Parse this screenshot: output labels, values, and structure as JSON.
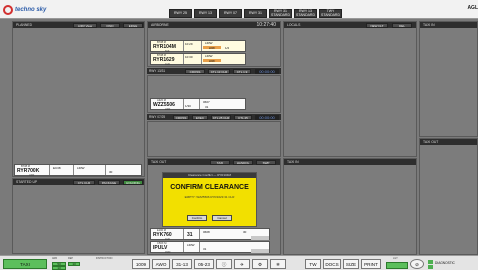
{
  "topbar": {
    "logo_text": "techno sky",
    "runway_buttons": [
      "RWY 25",
      "RWY 13",
      "RWY 07",
      "RWY 31",
      "RWY 31 STANDARD",
      "RWY 13 STANDARD",
      "TWY STANDARD"
    ],
    "user": "AGL"
  },
  "panels": {
    "planned": {
      "title": "PLANNED",
      "btn1": "AIRV View",
      "btn2": "FIND",
      "btn3": "EDGE"
    },
    "airborne": {
      "title": "AIRBORNE",
      "time": "10:27:40"
    },
    "locals": {
      "title": "LOCALS",
      "btn1": "NEW FLT",
      "btn2": "DEL"
    },
    "taxi_in": {
      "title": "TAXI IN"
    },
    "taxi_out_r": {
      "title": "TAXI OUT"
    },
    "startup": {
      "title": "STARTED UP",
      "btn1": "CTL CLR",
      "btn2": "PACKAGE",
      "btn3": "HOLDING"
    },
    "taxi_out": {
      "title": "TAXI OUT",
      "btn1": "TAXI",
      "btn2": "HANDOL",
      "btn3": "SWP"
    },
    "taxi_in_m": {
      "title": "TAXI IN"
    }
  },
  "bars": {
    "rwy1331": {
      "label": "RWY 13/31",
      "b1": "CROSS",
      "b2": "CTL 13 CLR",
      "b3": "CTL 1.9",
      "time": "00:00:00"
    },
    "rwy0725": {
      "label": "RWY 07/25",
      "b1": "CROSS",
      "b2": "EXEC",
      "b3": "CTL 25 CLR",
      "b4": "CTL 25",
      "time": "00:00:00"
    }
  },
  "strips": {
    "ryr104m": {
      "callsign": "RYR104M",
      "type": "B738 M",
      "sub": "TAK",
      "f1": "10:29",
      "f2": "LIRW",
      "f3": "LIRF",
      "f4": "1/2"
    },
    "ryr1629": {
      "callsign": "RYR1629",
      "type": "B738 M",
      "sub": "CLR",
      "f1": "10:30",
      "f2": "LIRW",
      "f3": "LIRF",
      "f4": ""
    },
    "wzz5506": {
      "callsign": "WZZ5506",
      "type": "A320 M",
      "sub": "LIRF",
      "f1": "1/30",
      "f2": "0607",
      "f3": "31",
      "f4": ""
    },
    "ryr700k": {
      "callsign": "RYR700K",
      "type": "B738 M",
      "sub": "LIRF",
      "f1": "EC38",
      "f2": "LIRW",
      "f3": "30",
      "f4": ""
    },
    "ryk760": {
      "callsign": "RYK760",
      "type": "E190 M",
      "sub": "CLR",
      "f1": "31",
      "f2": "0608",
      "f3": "30",
      "f4": ""
    },
    "ipulv": {
      "callsign": "IPULV",
      "type": "C56X M",
      "sub": "1530",
      "f1": "LIRW",
      "f2": "31",
      "f3": "",
      "f4": ""
    }
  },
  "dialog": {
    "titlebar": "Clearance Conflict — RYR104M",
    "title": "CONFIRM CLEARANCE",
    "message": "EMPTY: WZZ5506 RYR1629 31 CLR",
    "confirm": "Confirm",
    "cancel": "Cancel"
  },
  "bottombar": {
    "taxi_label": "TAXI",
    "small1": "ARR",
    "small2": "DEP",
    "small3": "INSTRUCTION",
    "green1": "53",
    "green2": "13",
    "green3": "13",
    "qnh": "1009",
    "awo": "AWO",
    "t1": "31-13",
    "t2": "05-23",
    "tw": "TW",
    "docs": "DOCS",
    "size": "SIZE",
    "print": "PRINT",
    "lgt": "LGT",
    "diag": "DIAGNOSTIC"
  }
}
